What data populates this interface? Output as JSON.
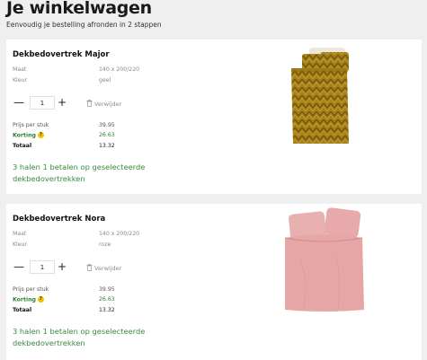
{
  "header": {
    "title": "Je winkelwagen",
    "subtitle": "Eenvoudig je bestelling afronden in 2 stappen"
  },
  "cart_items": [
    {
      "name": "Dekbedovertrek Major",
      "size_label": "Maat",
      "size_value": "140 x 200/220",
      "color_label": "Kleur",
      "color_value": "geel",
      "quantity": "1",
      "remove_label": "Verwijder",
      "unit_price_label": "Prijs per stuk",
      "unit_price": "39.95",
      "discount_label": "Korting",
      "discount": "26.63",
      "total_label": "Totaal",
      "total": "13.32",
      "promo": "3 halen 1 betalen op geselecteerde dekbedovertrekken",
      "image_color": "#b08a1e"
    },
    {
      "name": "Dekbedovertrek Nora",
      "size_label": "Maat",
      "size_value": "140 x 200/220",
      "color_label": "Kleur",
      "color_value": "roze",
      "quantity": "1",
      "remove_label": "Verwijder",
      "unit_price_label": "Prijs per stuk",
      "unit_price": "39.95",
      "discount_label": "Korting",
      "discount": "26.63",
      "total_label": "Totaal",
      "total": "13.32",
      "promo": "3 halen 1 betalen op geselecteerde dekbedovertrekken",
      "image_color": "#e4a1a1"
    }
  ],
  "colors": {
    "background": "#efefef",
    "promo_green": "#3a8a3a",
    "info_badge": "#f2c200"
  }
}
